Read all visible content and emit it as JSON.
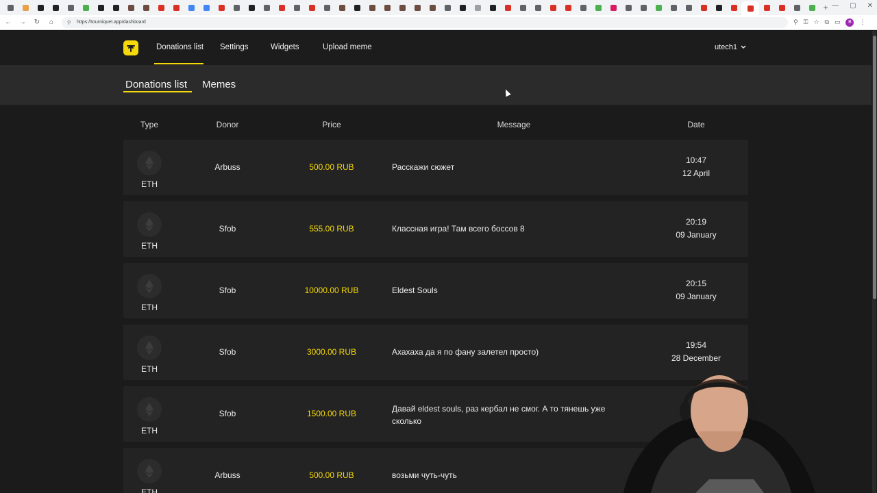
{
  "browser": {
    "url": "https://tourniquet.app/dashboard",
    "tab_colors": [
      "#5f6368",
      "#e8a04a",
      "#202124",
      "#202124",
      "#5f6368",
      "#4caf50",
      "#202124",
      "#202124",
      "#6d4c41",
      "#6d4c41",
      "#d93025",
      "#d93025",
      "#4285f4",
      "#4285f4",
      "#d93025",
      "#5f6368",
      "#202124",
      "#5f6368",
      "#d93025",
      "#5f6368",
      "#d93025",
      "#5f6368",
      "#6d4c41",
      "#202124",
      "#6d4c41",
      "#6d4c41",
      "#6d4c41",
      "#6d4c41",
      "#6d4c41",
      "#5f6368",
      "#202124",
      "#9aa0a6",
      "#202124",
      "#d93025",
      "#5f6368",
      "#5f6368",
      "#d93025",
      "#d93025",
      "#5f6368",
      "#4caf50",
      "#d81b60",
      "#5f6368",
      "#5f6368",
      "#4caf50",
      "#5f6368",
      "#5f6368",
      "#d93025",
      "#202124",
      "#d93025",
      "#d93025",
      "#d93025",
      "#d93025",
      "#5f6368",
      "#4caf50"
    ],
    "new_tab": "+"
  },
  "nav": {
    "items": [
      "Donations list",
      "Settings",
      "Widgets",
      "Upload meme"
    ],
    "user": "utech1"
  },
  "subnav": {
    "tabs": [
      "Donations list",
      "Memes"
    ]
  },
  "table": {
    "headers": {
      "type": "Type",
      "donor": "Donor",
      "price": "Price",
      "message": "Message",
      "date": "Date"
    },
    "rows": [
      {
        "type": "ETH",
        "donor": "Arbuss",
        "price": "500.00 RUB",
        "message": "Расскажи сюжет",
        "time": "10:47",
        "day": "12 April"
      },
      {
        "type": "ETH",
        "donor": "Sfob",
        "price": "555.00 RUB",
        "message": "Классная игра! Там всего боссов 8",
        "time": "20:19",
        "day": "09 January"
      },
      {
        "type": "ETH",
        "donor": "Sfob",
        "price": "10000.00 RUB",
        "message": "Eldest Souls",
        "time": "20:15",
        "day": "09 January"
      },
      {
        "type": "ETH",
        "donor": "Sfob",
        "price": "3000.00 RUB",
        "message": "Ахахаха да я по фану залетел просто)",
        "time": "19:54",
        "day": "28 December"
      },
      {
        "type": "ETH",
        "donor": "Sfob",
        "price": "1500.00 RUB",
        "message": "Давай eldest souls, раз кербал не смог. А то тянешь уже сколько",
        "time": "",
        "day": ""
      },
      {
        "type": "ETH",
        "donor": "Arbuss",
        "price": "500.00 RUB",
        "message": "возьми чуть-чуть",
        "time": "",
        "day": ""
      }
    ]
  },
  "colors": {
    "accent": "#f5d90a",
    "background": "#1b1b1b",
    "row": "#232323"
  }
}
